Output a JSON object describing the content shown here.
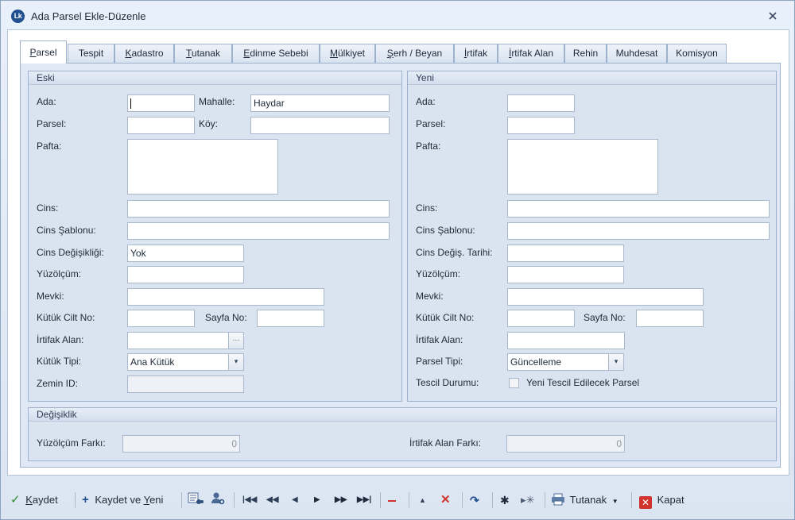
{
  "window": {
    "title": "Ada Parsel Ekle-Düzenle",
    "logo_text": "Lk"
  },
  "tabs": [
    {
      "label": "Parsel",
      "u": "P",
      "rest": "arsel"
    },
    {
      "label": "Tespit",
      "u": "",
      "rest": "Tespit"
    },
    {
      "label": "Kadastro",
      "u": "K",
      "rest": "adastro"
    },
    {
      "label": "Tutanak",
      "u": "T",
      "rest": "utanak"
    },
    {
      "label": "Edinme Sebebi",
      "u": "E",
      "rest": "dinme Sebebi"
    },
    {
      "label": "Mülkiyet",
      "u": "M",
      "rest": "ülkiyet"
    },
    {
      "label": "Şerh / Beyan",
      "u": "Ş",
      "rest": "erh / Beyan"
    },
    {
      "label": "İrtifak",
      "u": "İ",
      "rest": "rtifak"
    },
    {
      "label": "İrtifak Alan",
      "u": "İ",
      "rest": "rtifak Alan"
    },
    {
      "label": "Rehin",
      "u": "",
      "rest": "Rehin"
    },
    {
      "label": "Muhdesat",
      "u": "",
      "rest": "Muhdesat"
    },
    {
      "label": "Komisyon",
      "u": "",
      "rest": "Komisyon"
    }
  ],
  "eski": {
    "title": "Eski",
    "ada_label": "Ada:",
    "ada_value": "",
    "mahalle_label": "Mahalle:",
    "mahalle_value": "Haydar",
    "parsel_label": "Parsel:",
    "parsel_value": "",
    "koy_label": "Köy:",
    "koy_value": "",
    "pafta_label": "Pafta:",
    "pafta_value": "",
    "cins_label": "Cins:",
    "cins_value": "",
    "cins_sablonu_label": "Cins Şablonu:",
    "cins_sablonu_value": "",
    "cins_degisikligi_label": "Cins Değişikliği:",
    "cins_degisikligi_value": "Yok",
    "yuzolcum_label": "Yüzölçüm:",
    "yuzolcum_value": "",
    "mevki_label": "Mevki:",
    "mevki_value": "",
    "kutuk_cilt_label": "Kütük Cilt No:",
    "kutuk_cilt_value": "",
    "sayfa_label": "Sayfa No:",
    "sayfa_value": "",
    "irtifak_alan_label": "İrtifak Alan:",
    "irtifak_alan_value": "",
    "ellipsis": "···",
    "kutuk_tipi_label": "Kütük Tipi:",
    "kutuk_tipi_value": "Ana Kütük",
    "zemin_label": "Zemin ID:",
    "zemin_value": ""
  },
  "yeni": {
    "title": "Yeni",
    "ada_label": "Ada:",
    "ada_value": "",
    "parsel_label": "Parsel:",
    "parsel_value": "",
    "pafta_label": "Pafta:",
    "pafta_value": "",
    "cins_label": "Cins:",
    "cins_value": "",
    "cins_sablonu_label": "Cins Şablonu:",
    "cins_sablonu_value": "",
    "cins_degis_tarihi_label": "Cins Değiş. Tarihi:",
    "cins_degis_tarihi_value": "",
    "yuzolcum_label": "Yüzölçüm:",
    "yuzolcum_value": "",
    "mevki_label": "Mevki:",
    "mevki_value": "",
    "kutuk_cilt_label": "Kütük Cilt No:",
    "kutuk_cilt_value": "",
    "sayfa_label": "Sayfa No:",
    "sayfa_value": "",
    "irtifak_alan_label": "İrtifak Alan:",
    "irtifak_alan_value": "",
    "parsel_tipi_label": "Parsel Tipi:",
    "parsel_tipi_value": "Güncelleme",
    "tescil_durumu_label": "Tescil Durumu:",
    "tescil_checkbox_label": "Yeni Tescil Edilecek Parsel"
  },
  "degisiklik": {
    "title": "Değişiklik",
    "yuzolcum_farki_label": "Yüzölçüm Farkı:",
    "yuzolcum_farki_value": "0",
    "irtifak_farki_label": "İrtifak Alan Farkı:",
    "irtifak_farki_value": "0"
  },
  "toolbar": {
    "kaydet_u": "K",
    "kaydet_rest": "aydet",
    "kaydet_yeni_pre": "Kaydet ve ",
    "kaydet_yeni_u": "Y",
    "kaydet_yeni_rest": "eni",
    "tutanak": "Tutanak",
    "kapat": "Kapat"
  },
  "colors": {
    "accent": "#1f4f8f",
    "danger": "#d0342c",
    "ok": "#2e8b2e"
  }
}
